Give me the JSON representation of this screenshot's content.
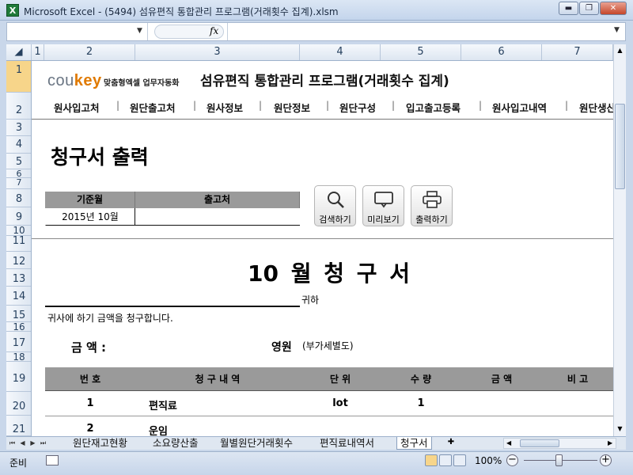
{
  "window": {
    "title": "Microsoft Excel - (5494) 섬유편직 통합관리 프로그램(거래횟수 집계).xlsm",
    "app_icon": "X",
    "controls": [
      "minimize-icon",
      "restore-icon",
      "close-icon"
    ]
  },
  "formula_bar": {
    "name_box": "",
    "fx_label": "fx",
    "value": ""
  },
  "columns": [
    "1",
    "2",
    "3",
    "4",
    "5",
    "6",
    "7"
  ],
  "rows": [
    "1",
    "2",
    "3",
    "4",
    "5",
    "6",
    "7",
    "8",
    "9",
    "10",
    "11",
    "12",
    "13",
    "14",
    "15",
    "16",
    "17",
    "18",
    "19",
    "20",
    "21"
  ],
  "header": {
    "logo_main": "cou",
    "logo_accent": "key",
    "logo_sub": "맞춤형엑셀 업무자동화",
    "title": "섬유편직 통합관리 프로그램(거래횟수 집계)"
  },
  "nav": [
    "원사입고처",
    "원단출고처",
    "원사정보",
    "원단정보",
    "원단구성",
    "입고출고등록",
    "원사입고내역",
    "원단생산"
  ],
  "section_title": "청구서 출력",
  "filters": {
    "month_label": "기준월",
    "month_value": "2015년 10월",
    "dest_label": "출고처",
    "dest_value": ""
  },
  "tools": [
    {
      "label": "검색하기",
      "icon": "search-icon"
    },
    {
      "label": "미리보기",
      "icon": "preview-monitor-icon"
    },
    {
      "label": "출력하기",
      "icon": "printer-icon"
    }
  ],
  "invoice": {
    "title": "10 월  청 구 서",
    "recipient_suffix": "귀하",
    "note": "귀사에 하기 금액을 청구합니다.",
    "amount_label": "금 액 :",
    "amount_unit": "영원",
    "vat_note": "(부가세별도)",
    "table_headers": [
      "번 호",
      "청 구 내 역",
      "단 위",
      "수 량",
      "금 액",
      "비 고"
    ],
    "rows": [
      {
        "no": "1",
        "item": "편직료",
        "unit": "lot",
        "qty": "1",
        "amount": "",
        "remark": ""
      },
      {
        "no": "2",
        "item": "운임",
        "unit": "",
        "qty": "",
        "amount": "",
        "remark": ""
      }
    ]
  },
  "sheet_tabs": [
    "원단재고현황",
    "소요량산출",
    "월별원단거래횟수",
    "편직료내역서",
    "청구서"
  ],
  "active_tab": "청구서",
  "status": {
    "ready": "준비",
    "zoom": "100%"
  },
  "colors": {
    "accent_orange": "#e07a00",
    "header_gray": "#9a9a9a",
    "excel_blue": "#c9d7ea"
  }
}
